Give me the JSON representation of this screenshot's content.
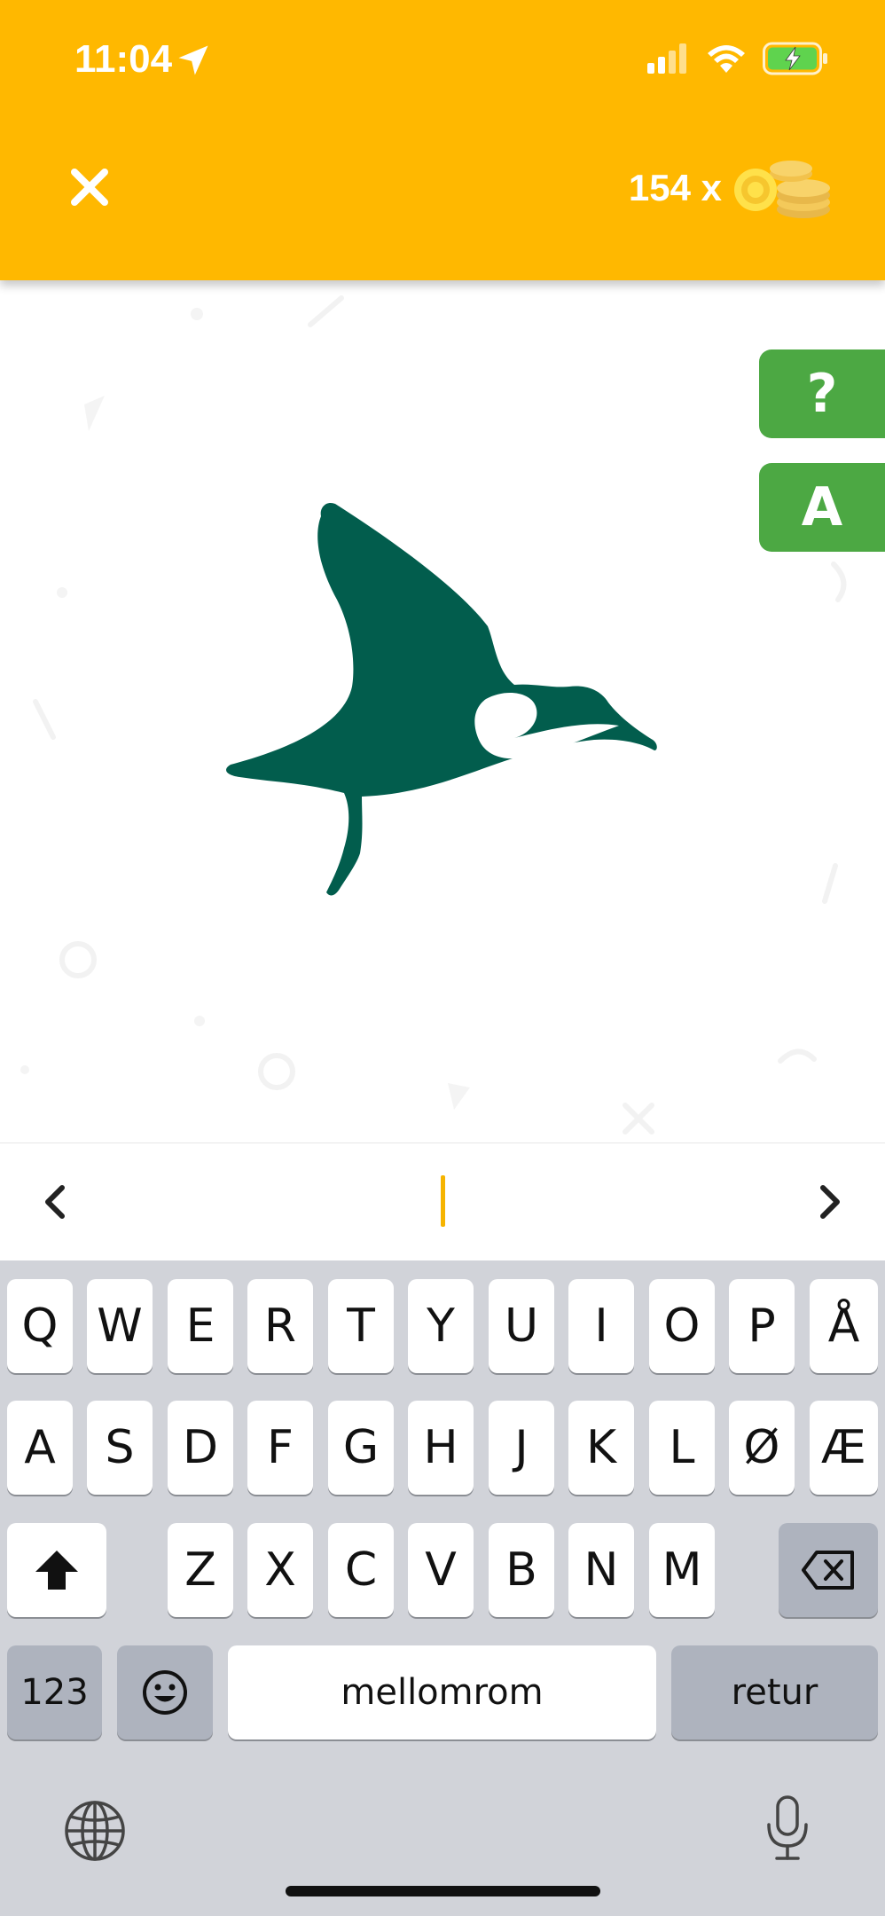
{
  "status_bar": {
    "time": "11:04"
  },
  "header": {
    "close_icon": "close-icon",
    "coins_text": "154 x",
    "coins_icon": "coins-icon",
    "background_color": "#FFB800"
  },
  "side_buttons": {
    "hint_label": "?",
    "answer_label": "A",
    "color": "#4CA843"
  },
  "input": {
    "prev_icon": "chevron-left-icon",
    "next_icon": "chevron-right-icon",
    "cursor_color": "#F6B400"
  },
  "keyboard": {
    "row1": [
      "Q",
      "W",
      "E",
      "R",
      "T",
      "Y",
      "U",
      "I",
      "O",
      "P",
      "Å"
    ],
    "row2": [
      "A",
      "S",
      "D",
      "F",
      "G",
      "H",
      "J",
      "K",
      "L",
      "Ø",
      "Æ"
    ],
    "row3": [
      "Z",
      "X",
      "C",
      "V",
      "B",
      "N",
      "M"
    ],
    "numbers_label": "123",
    "space_label": "mellomrom",
    "return_label": "retur",
    "shift_icon": "shift-icon",
    "delete_icon": "backspace-icon",
    "emoji_icon": "emoji-icon",
    "globe_icon": "globe-icon",
    "mic_icon": "microphone-icon"
  }
}
